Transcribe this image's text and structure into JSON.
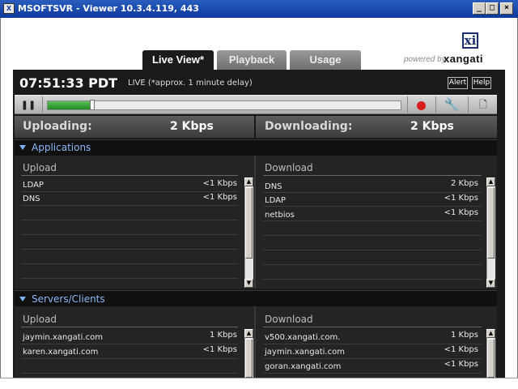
{
  "window": {
    "title": "MSOFTSVR - Viewer 10.3.4.119, 443",
    "icon": "xangati-app-icon",
    "controls": {
      "minimize": "_",
      "maximize": "□",
      "close": "×"
    }
  },
  "tabs": [
    {
      "label": "Live View*",
      "active": true
    },
    {
      "label": "Playback",
      "active": false
    },
    {
      "label": "Usage",
      "active": false
    }
  ],
  "logo": {
    "mark": "xi",
    "powered_by": "powered by",
    "brand": "xangati"
  },
  "status": {
    "time": "07:51:33 PDT",
    "live_note": "LIVE (*approx. 1 minute  delay)",
    "alert_label": "Alert",
    "help_label": "Help"
  },
  "playback": {
    "pause_icon": "pause-icon",
    "progress_fraction": 0.12,
    "record_icon": "record-icon",
    "settings_icon": "wrench-icon",
    "report_icon": "document-icon",
    "pause_glyph": "❚❚",
    "wrench_glyph": "🔧",
    "doc_glyph": "🗋"
  },
  "rates": {
    "uploading_label": "Uploading:",
    "uploading_value": "2 Kbps",
    "downloading_label": "Downloading:",
    "downloading_value": "2 Kbps"
  },
  "applications": {
    "label": "Applications",
    "upload": {
      "title": "Upload",
      "rows": [
        {
          "name": "LDAP",
          "rate": "<1 Kbps"
        },
        {
          "name": "DNS",
          "rate": "<1 Kbps"
        }
      ]
    },
    "download": {
      "title": "Download",
      "rows": [
        {
          "name": "DNS",
          "rate": "2  Kbps"
        },
        {
          "name": "LDAP",
          "rate": "<1 Kbps"
        },
        {
          "name": "netbios",
          "rate": "<1 Kbps"
        }
      ]
    }
  },
  "servers_clients": {
    "label": "Servers/Clients",
    "upload": {
      "title": "Upload",
      "rows": [
        {
          "name": "jaymin.xangati.com",
          "rate": "1  Kbps"
        },
        {
          "name": "karen.xangati.com",
          "rate": "<1 Kbps"
        }
      ]
    },
    "download": {
      "title": "Download",
      "rows": [
        {
          "name": "v500.xangati.com.",
          "rate": "1  Kbps"
        },
        {
          "name": "jaymin.xangati.com",
          "rate": "<1 Kbps"
        },
        {
          "name": "goran.xangati.com",
          "rate": "<1 Kbps"
        }
      ]
    }
  },
  "scroll_arrows": {
    "up": "▲",
    "down": "▼"
  },
  "colors": {
    "accent_blue": "#8ab8f5",
    "progress_green": "#2e9e2e",
    "record_red": "#d81d1d",
    "panel_bg": "#242424"
  }
}
